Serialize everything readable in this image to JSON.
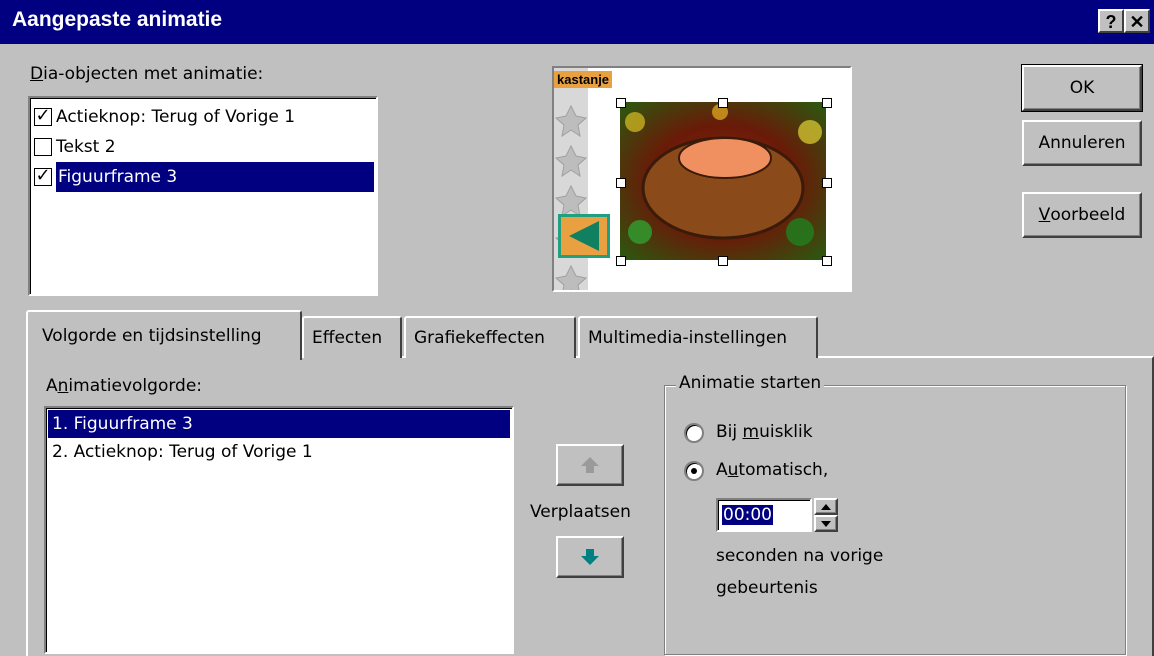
{
  "window": {
    "title": "Aangepaste animatie",
    "help_button": "?",
    "close_button": "✕"
  },
  "objects_list": {
    "label_underlined": "D",
    "label_rest": "ia-objecten met animatie:",
    "items": [
      {
        "label": "Actieknop: Terug of Vorige 1",
        "checked": true,
        "selected": false
      },
      {
        "label": "Tekst 2",
        "checked": false,
        "selected": false
      },
      {
        "label": "Figuurframe 3",
        "checked": true,
        "selected": true
      }
    ]
  },
  "preview": {
    "slide_title": "kastanje"
  },
  "buttons": {
    "ok": "OK",
    "cancel": "Annuleren",
    "preview_underlined": "V",
    "preview_rest": "oorbeeld"
  },
  "tabs": [
    {
      "label": "Volgorde en tijdsinstelling",
      "active": true
    },
    {
      "label": "Effecten",
      "active": false
    },
    {
      "label": "Grafiekeffecten",
      "active": false
    },
    {
      "label": "Multimedia-instellingen",
      "active": false
    }
  ],
  "order": {
    "label_before": "A",
    "label_underlined": "n",
    "label_rest": "imatievolgorde:",
    "items": [
      {
        "label": "1. Figuurframe 3",
        "selected": true
      },
      {
        "label": "2. Actieknop: Terug of Vorige 1",
        "selected": false
      }
    ],
    "move_label": "Verplaatsen"
  },
  "start": {
    "group_title": "Animatie starten",
    "on_click_before": "Bij ",
    "on_click_underlined": "m",
    "on_click_rest": "uisklik",
    "auto_before": "A",
    "auto_underlined": "u",
    "auto_rest": "tomatisch,",
    "selected": "automatic",
    "time_value": "00:00",
    "after_line1": "seconden na vorige",
    "after_line2": "gebeurtenis"
  },
  "colors": {
    "title_bar": "#000080",
    "selection": "#000080",
    "face": "#c0c0c0",
    "move_arrow": "#008080"
  }
}
